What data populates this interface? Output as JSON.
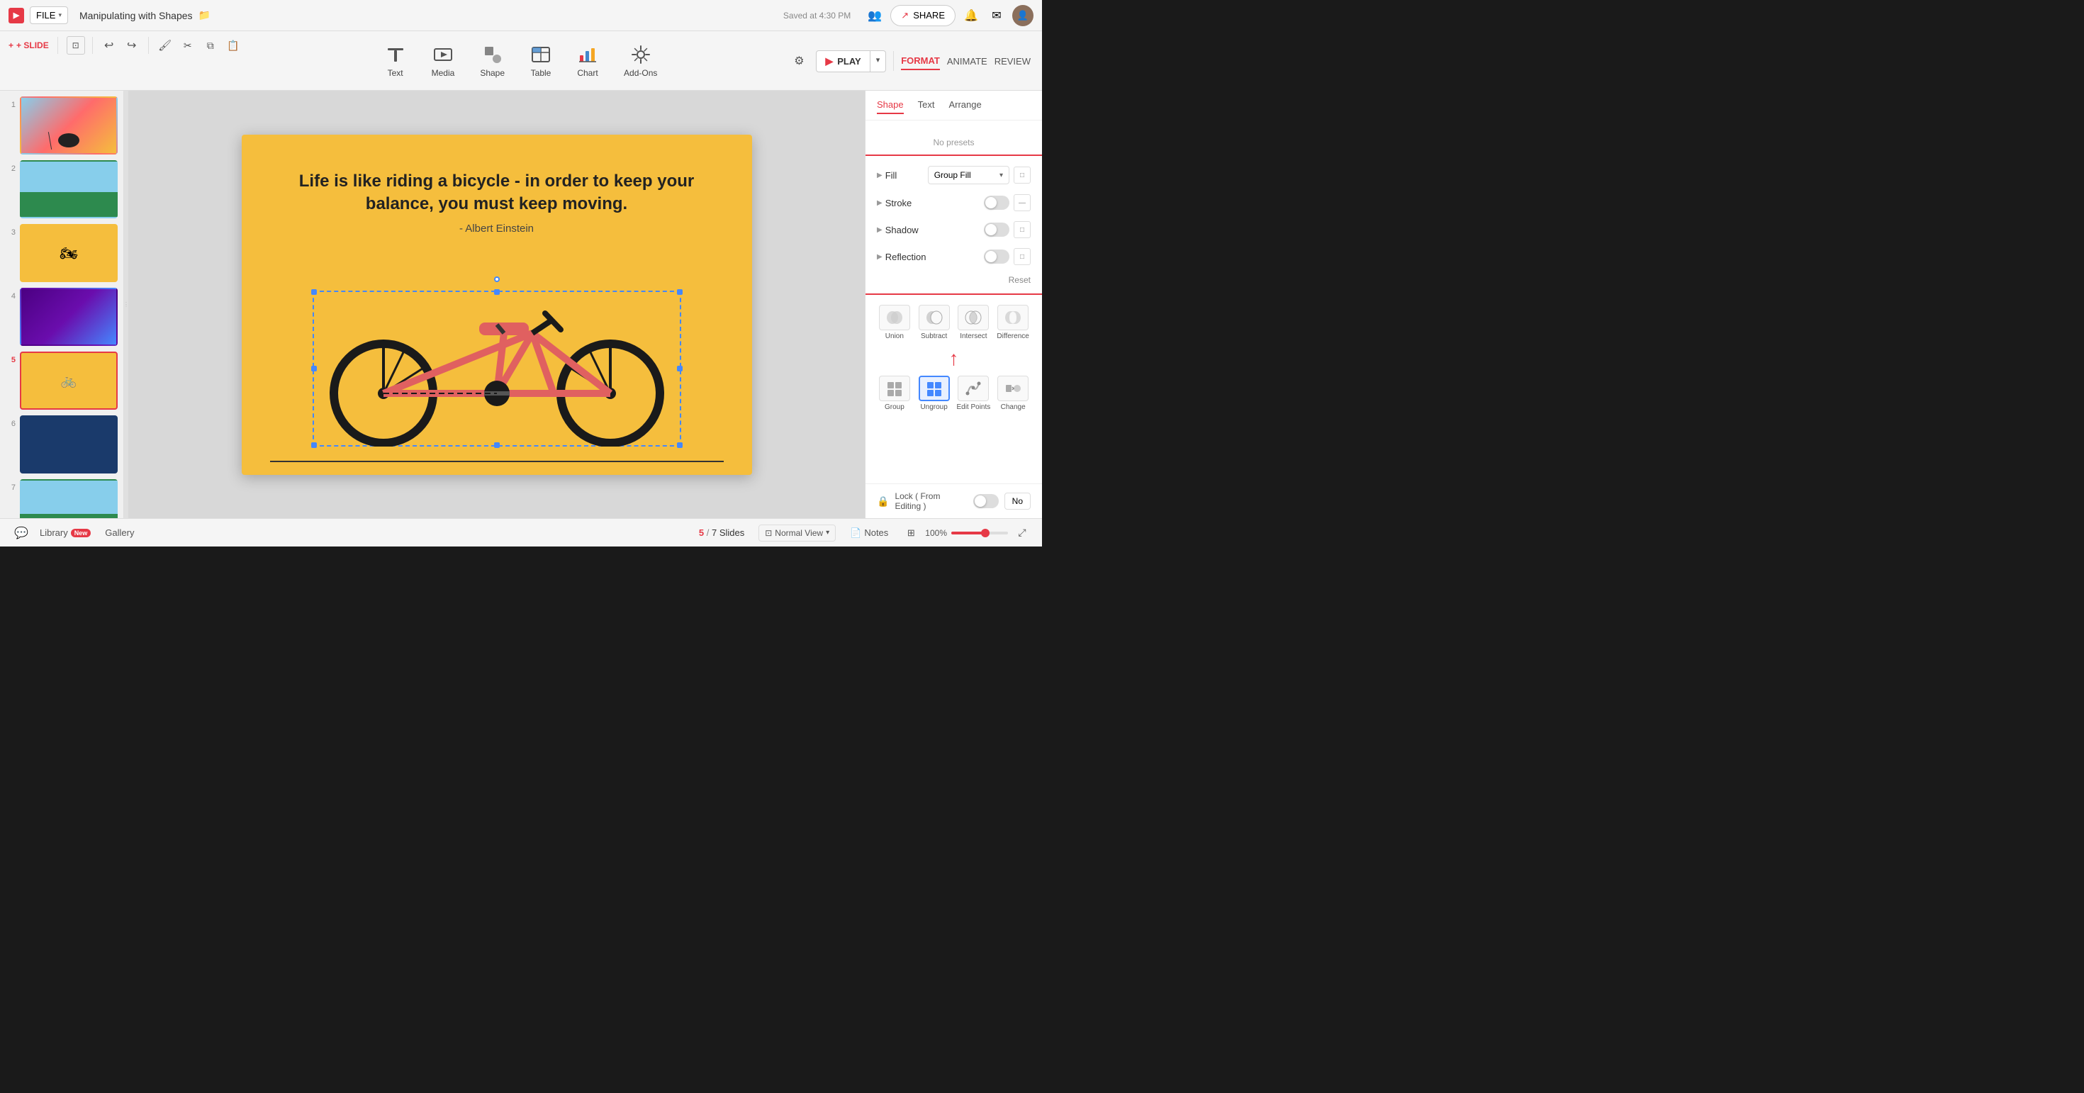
{
  "app": {
    "logo": "P",
    "file_label": "FILE",
    "doc_title": "Manipulating with Shapes",
    "saved_text": "Saved at 4:30 PM",
    "share_label": "SHARE"
  },
  "toolbar": {
    "slide_label": "+ SLIDE",
    "undo": "↩",
    "redo": "↪"
  },
  "insert_items": [
    {
      "id": "text",
      "label": "Text"
    },
    {
      "id": "media",
      "label": "Media"
    },
    {
      "id": "shape",
      "label": "Shape"
    },
    {
      "id": "table",
      "label": "Table"
    },
    {
      "id": "chart",
      "label": "Chart"
    },
    {
      "id": "addons",
      "label": "Add-Ons"
    }
  ],
  "play": {
    "label": "PLAY"
  },
  "format_tabs": [
    {
      "id": "format",
      "label": "FORMAT",
      "active": true
    },
    {
      "id": "animate",
      "label": "ANIMATE",
      "active": false
    },
    {
      "id": "review",
      "label": "REVIEW",
      "active": false
    }
  ],
  "panel_tabs": [
    {
      "id": "shape",
      "label": "Shape",
      "active": true
    },
    {
      "id": "text",
      "label": "Text",
      "active": false
    },
    {
      "id": "arrange",
      "label": "Arrange",
      "active": false
    }
  ],
  "panel": {
    "no_presets": "No presets",
    "fill_label": "Fill",
    "fill_value": "Group Fill",
    "stroke_label": "Stroke",
    "shadow_label": "Shadow",
    "reflection_label": "Reflection",
    "reset_label": "Reset"
  },
  "shape_ops": [
    {
      "id": "union",
      "label": "Union"
    },
    {
      "id": "subtract",
      "label": "Subtract"
    },
    {
      "id": "intersect",
      "label": "Intersect"
    },
    {
      "id": "difference",
      "label": "Difference"
    }
  ],
  "shape_ops2": [
    {
      "id": "group",
      "label": "Group"
    },
    {
      "id": "ungroup",
      "label": "Ungroup"
    },
    {
      "id": "edit-points",
      "label": "Edit Points"
    },
    {
      "id": "change",
      "label": "Change"
    }
  ],
  "lock": {
    "label": "Lock ( From Editing )",
    "value": "No"
  },
  "slide": {
    "quote": "Life is like riding a bicycle - in order to keep your balance, you must keep moving.",
    "author": "- Albert Einstein"
  },
  "slides": [
    {
      "num": "1"
    },
    {
      "num": "2"
    },
    {
      "num": "3"
    },
    {
      "num": "4"
    },
    {
      "num": "5"
    },
    {
      "num": "6"
    },
    {
      "num": "7"
    }
  ],
  "bottom": {
    "library_label": "Library",
    "new_badge": "New",
    "gallery_label": "Gallery",
    "current_slide": "5",
    "total_slides": "7 Slides",
    "view_label": "Normal View",
    "notes_label": "Notes",
    "zoom_value": "100%"
  }
}
